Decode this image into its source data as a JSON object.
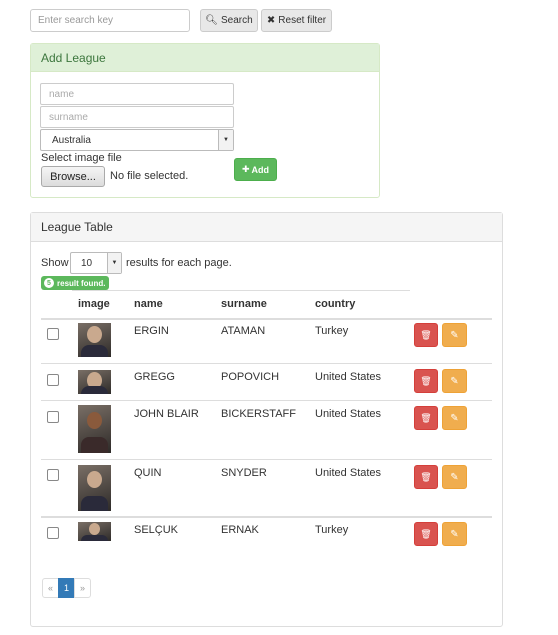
{
  "search": {
    "placeholder": "Enter search key",
    "search_label": "Search",
    "reset_label": "Reset filter"
  },
  "add_league": {
    "title": "Add League",
    "name_placeholder": "name",
    "surname_placeholder": "surname",
    "country_selected": "Australia",
    "image_label": "Select image file",
    "browse_label": "Browse...",
    "file_status": "No file selected.",
    "add_label": "Add"
  },
  "league_table": {
    "title": "League Table",
    "show_label": "Show",
    "page_size": "10",
    "per_page_label": "results for each page.",
    "result_count": "5",
    "result_label": "result found.",
    "columns": [
      "image",
      "name",
      "surname",
      "country"
    ],
    "rows": [
      {
        "name": "ERGIN",
        "surname": "ATAMAN",
        "country": "Turkey"
      },
      {
        "name": "GREGG",
        "surname": "POPOVICH",
        "country": "United States"
      },
      {
        "name": "JOHN BLAIR",
        "surname": "BICKERSTAFF",
        "country": "United States"
      },
      {
        "name": "QUIN",
        "surname": "SNYDER",
        "country": "United States"
      },
      {
        "name": "SELÇUK",
        "surname": "ERNAK",
        "country": "Turkey"
      }
    ]
  },
  "pagination": {
    "prev": "«",
    "current": "1",
    "next": "»"
  },
  "colors": {
    "success": "#5cb85c",
    "danger": "#d9534f",
    "warning": "#f0ad4e",
    "primary": "#337ab7",
    "panel_success_bg": "#dff0d8"
  },
  "icons": [
    "search-icon",
    "close-icon",
    "plus-icon",
    "trash-icon",
    "pencil-icon",
    "caret-down-icon"
  ]
}
